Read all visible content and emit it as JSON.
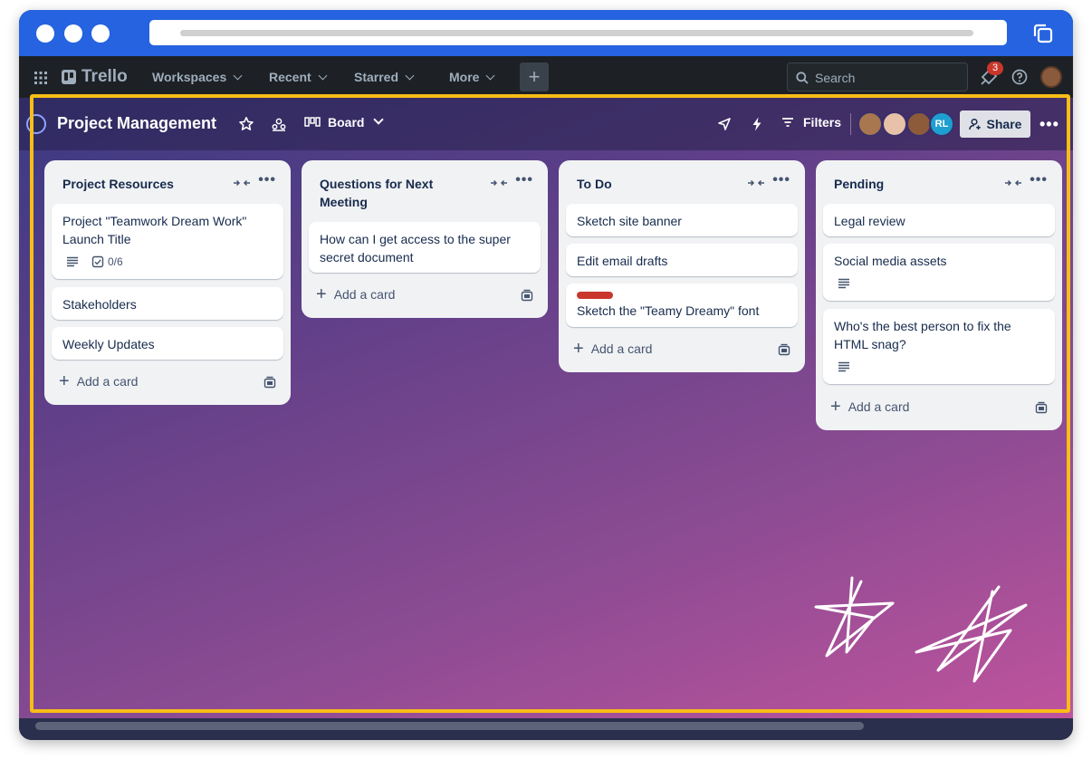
{
  "topnav": {
    "logo": "Trello",
    "menus": [
      {
        "label": "Workspaces"
      },
      {
        "label": "Recent"
      },
      {
        "label": "Starred"
      },
      {
        "label": "More"
      }
    ],
    "create_label": "+",
    "search_placeholder": "Search",
    "notification_count": "3"
  },
  "board": {
    "title": "Project Management",
    "view_label": "Board",
    "filters_label": "Filters",
    "share_label": "Share",
    "member_initials": "RL",
    "more_label": "•••"
  },
  "lists": [
    {
      "title": "Project Resources",
      "cards": [
        {
          "text": "Project \"Teamwork Dream Work\" Launch Title",
          "checklist": "0/6"
        },
        {
          "text": "Stakeholders"
        },
        {
          "text": "Weekly Updates"
        }
      ],
      "add_label": "Add a card"
    },
    {
      "title": "Questions for Next Meeting",
      "cards": [
        {
          "text": "How can I get access to the super secret document"
        }
      ],
      "add_label": "Add a card"
    },
    {
      "title": "To Do",
      "cards": [
        {
          "text": "Sketch site banner"
        },
        {
          "text": "Edit email drafts"
        },
        {
          "text": "Sketch the \"Teamy Dreamy\" font",
          "label_color": "#c9372c"
        }
      ],
      "add_label": "Add a card"
    },
    {
      "title": "Pending",
      "cards": [
        {
          "text": "Legal review"
        },
        {
          "text": "Social media assets"
        },
        {
          "text": "Who's the best person to fix the HTML snag?"
        }
      ],
      "add_label": "Add a card"
    }
  ],
  "colors": {
    "browser_chrome": "#2563e0",
    "highlight": "#f8bd16",
    "card_label_red": "#c9372c"
  }
}
